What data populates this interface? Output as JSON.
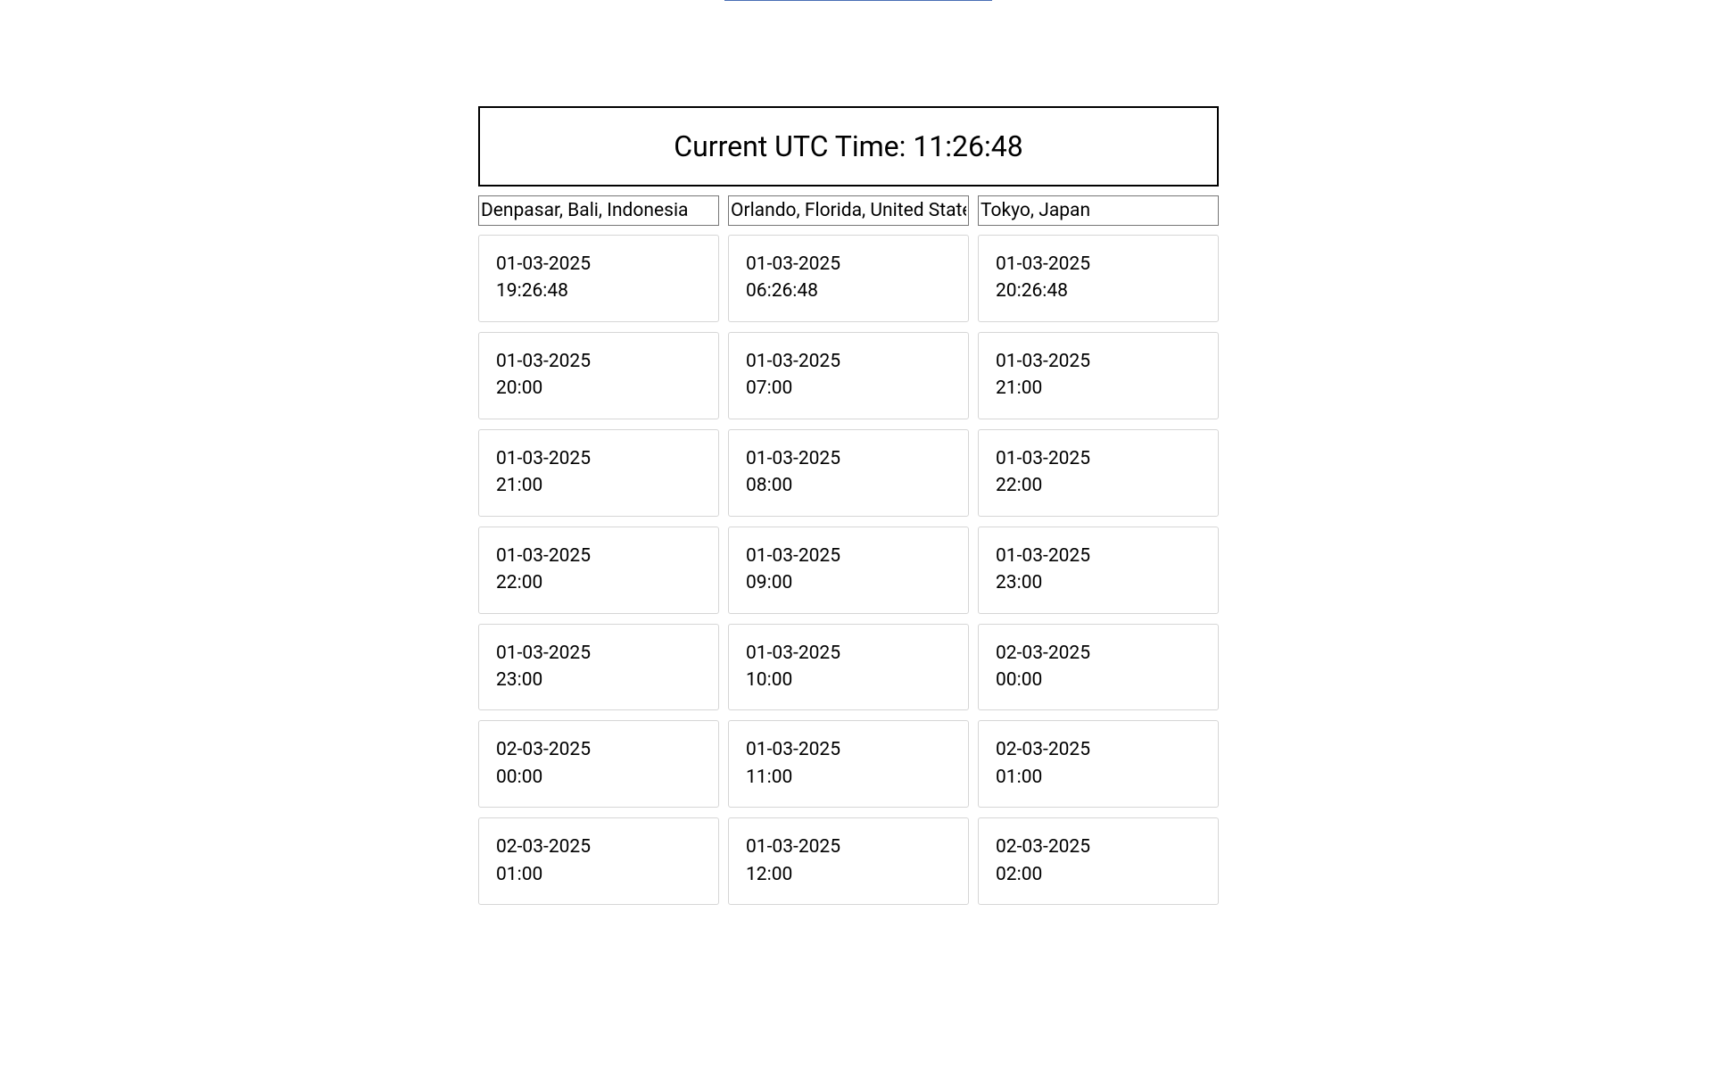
{
  "utc_header_prefix": "Current UTC Time: ",
  "utc_time": "11:26:48",
  "columns": [
    {
      "zone_value": "Denpasar, Bali, Indonesia",
      "rows": [
        {
          "date": "01-03-2025",
          "time": "19:26:48"
        },
        {
          "date": "01-03-2025",
          "time": "20:00"
        },
        {
          "date": "01-03-2025",
          "time": "21:00"
        },
        {
          "date": "01-03-2025",
          "time": "22:00"
        },
        {
          "date": "01-03-2025",
          "time": "23:00"
        },
        {
          "date": "02-03-2025",
          "time": "00:00"
        },
        {
          "date": "02-03-2025",
          "time": "01:00"
        }
      ]
    },
    {
      "zone_value": "Orlando, Florida, United States",
      "rows": [
        {
          "date": "01-03-2025",
          "time": "06:26:48"
        },
        {
          "date": "01-03-2025",
          "time": "07:00"
        },
        {
          "date": "01-03-2025",
          "time": "08:00"
        },
        {
          "date": "01-03-2025",
          "time": "09:00"
        },
        {
          "date": "01-03-2025",
          "time": "10:00"
        },
        {
          "date": "01-03-2025",
          "time": "11:00"
        },
        {
          "date": "01-03-2025",
          "time": "12:00"
        }
      ]
    },
    {
      "zone_value": "Tokyo, Japan",
      "rows": [
        {
          "date": "01-03-2025",
          "time": "20:26:48"
        },
        {
          "date": "01-03-2025",
          "time": "21:00"
        },
        {
          "date": "01-03-2025",
          "time": "22:00"
        },
        {
          "date": "01-03-2025",
          "time": "23:00"
        },
        {
          "date": "02-03-2025",
          "time": "00:00"
        },
        {
          "date": "02-03-2025",
          "time": "01:00"
        },
        {
          "date": "02-03-2025",
          "time": "02:00"
        }
      ]
    }
  ]
}
